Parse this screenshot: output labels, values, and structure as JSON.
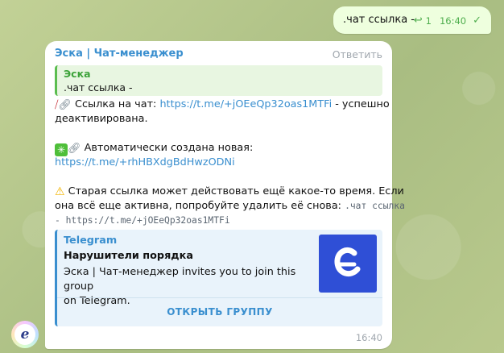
{
  "outgoing": {
    "text": ".чат ссылка -",
    "reply_count": "1",
    "time": "16:40"
  },
  "incoming": {
    "sender": "Эска | Чат-менеджер",
    "reply_label": "Ответить",
    "quote": {
      "author": "Эска",
      "text": ".чат ссылка -"
    },
    "line1_prefix": "Ссылка на чат:",
    "old_link": "https://t.me/+jOEeQp32oas1MTFi",
    "line1_suffix": "- успешно",
    "line2": "деактивирована.",
    "line3": "Автоматически создана новая:",
    "new_link": "https://t.me/+rhHBXdgBdHwzODNi",
    "line4": "Старая ссылка может действовать ещё какое-то время. Если",
    "line5_text": "она всё еще активна, попробуйте удалить её снова:",
    "line5_code": ".чат ссылка",
    "line6_code": "- https://t.me/+jOEeQp32oas1MTFi",
    "preview": {
      "site": "Telegram",
      "title": "Нарушители порядка",
      "desc_line1": "Эска | Чат-менеджер invites you to join this group",
      "desc_line2": "on Telegram.",
      "open_button": "ОТКРЫТЬ ГРУППУ"
    },
    "time": "16:40"
  },
  "colors": {
    "link": "#3a8fcf",
    "quote_accent": "#5bbd4f",
    "outgoing_bg": "#eeffde",
    "thumb_bg": "#2f4fd6"
  }
}
